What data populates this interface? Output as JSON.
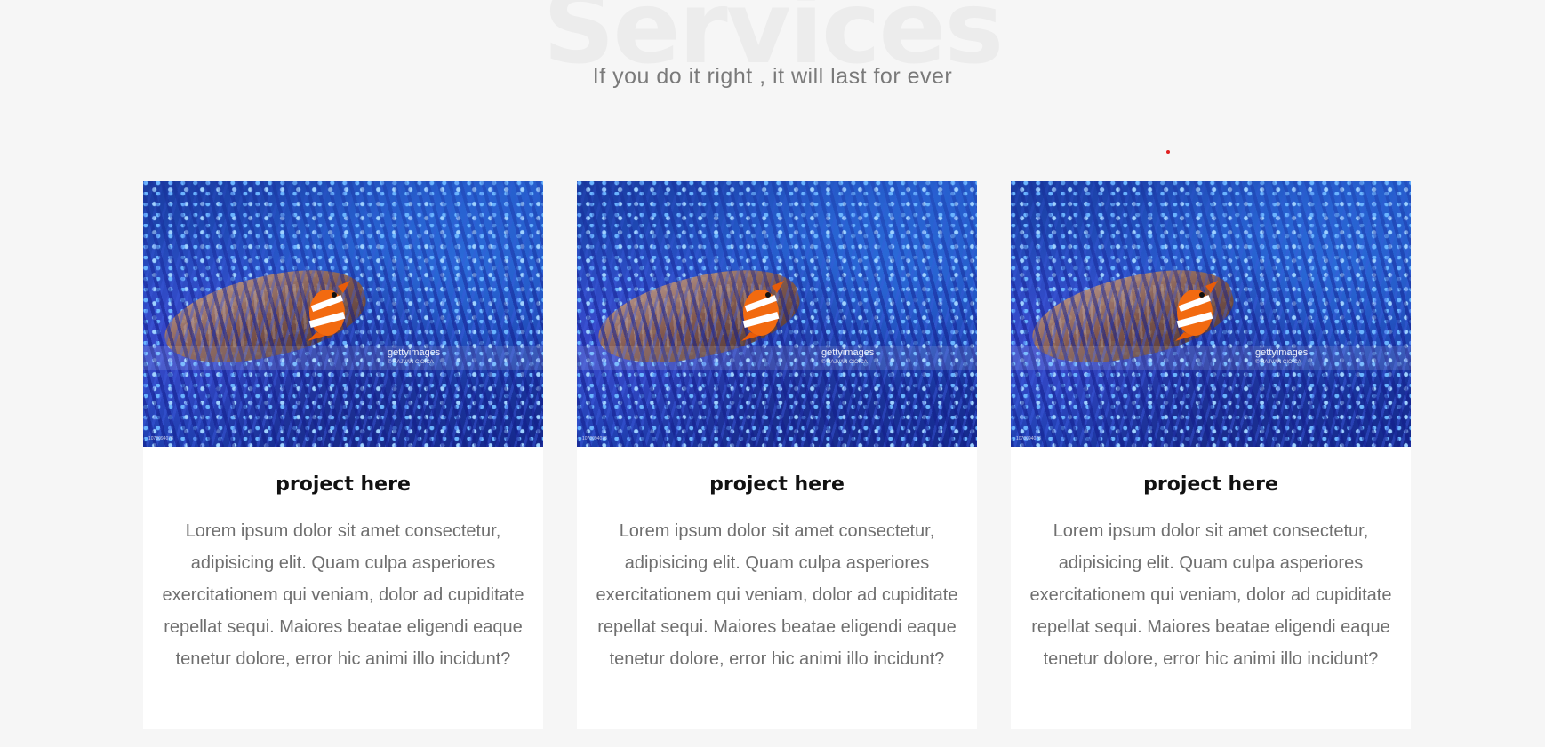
{
  "section": {
    "background_title": "Services",
    "subtitle": "If you do it right , it will last for ever"
  },
  "colors": {
    "page_background": "#f6f6f6",
    "card_background": "#ffffff",
    "title_text": "#111111",
    "body_text": "#6f6f6f",
    "accent_dot": "#e02020"
  },
  "cards": [
    {
      "image_watermark": "gettyimages",
      "image_credit": "© RAJVAN CIOICA",
      "image_id": "1070094078",
      "title": "project here",
      "text": "Lorem ipsum dolor sit amet consectetur, adipisicing elit. Quam culpa asperiores exercitationem qui veniam, dolor ad cupiditate repellat sequi. Maiores beatae eligendi eaque tenetur dolore, error hic animi illo incidunt?"
    },
    {
      "image_watermark": "gettyimages",
      "image_credit": "© RAJVAN CIOICA",
      "image_id": "1070094078",
      "title": "project here",
      "text": "Lorem ipsum dolor sit amet consectetur, adipisicing elit. Quam culpa asperiores exercitationem qui veniam, dolor ad cupiditate repellat sequi. Maiores beatae eligendi eaque tenetur dolore, error hic animi illo incidunt?"
    },
    {
      "image_watermark": "gettyimages",
      "image_credit": "© RAJVAN CIOICA",
      "image_id": "1070094078",
      "title": "project here",
      "text": "Lorem ipsum dolor sit amet consectetur, adipisicing elit. Quam culpa asperiores exercitationem qui veniam, dolor ad cupiditate repellat sequi. Maiores beatae eligendi eaque tenetur dolore, error hic animi illo incidunt?"
    }
  ]
}
